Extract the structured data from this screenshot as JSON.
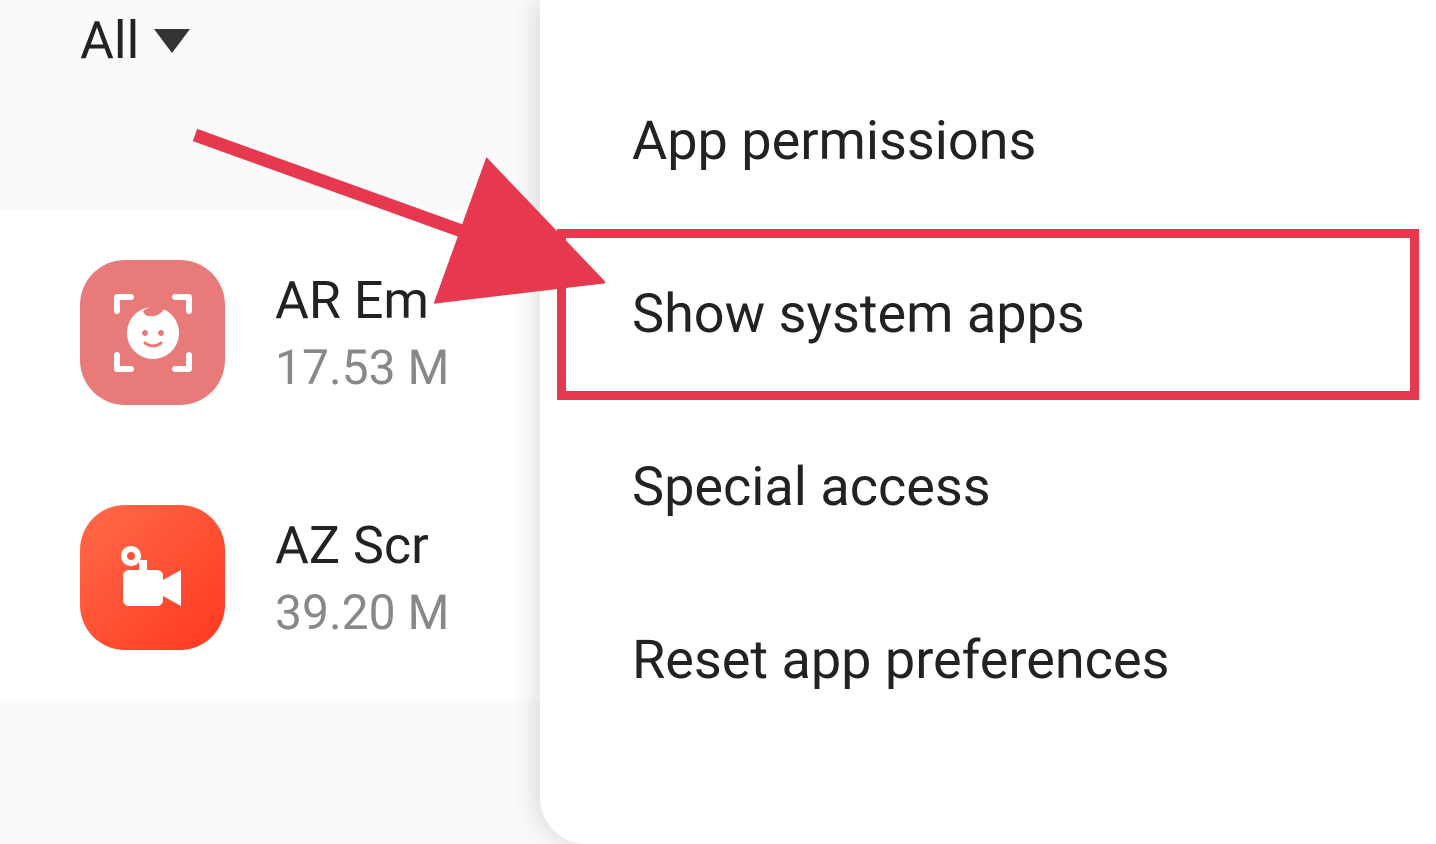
{
  "filter": {
    "label": "All"
  },
  "apps": [
    {
      "name": "AR Em",
      "size": "17.53 M"
    },
    {
      "name": "AZ Scr",
      "size": "39.20 M"
    }
  ],
  "menu": {
    "items": [
      "",
      "App permissions",
      "Show system apps",
      "Special access",
      "Reset app preferences"
    ]
  },
  "annotation": {
    "highlight_color": "#e63950"
  }
}
